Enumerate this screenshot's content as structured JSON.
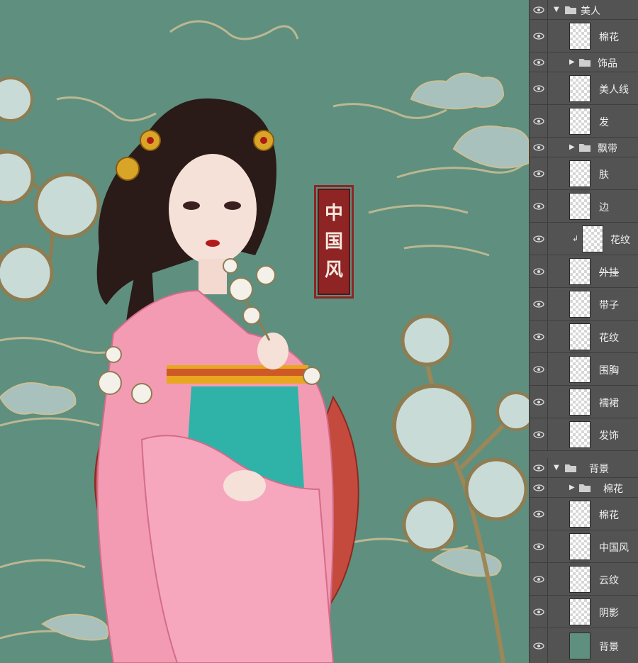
{
  "artwork": {
    "seal_text": [
      "中",
      "国",
      "风"
    ],
    "background_color": "#5f8f7e",
    "seal_color": "#8e2424"
  },
  "layers_panel": {
    "rows": [
      {
        "label": "美人",
        "kind": "group",
        "expanded": true,
        "visible": true
      },
      {
        "label": "棉花",
        "kind": "layer",
        "visible": true
      },
      {
        "label": "饰品",
        "kind": "group",
        "expanded": false,
        "visible": true
      },
      {
        "label": "美人线",
        "kind": "layer",
        "visible": true
      },
      {
        "label": "发",
        "kind": "layer",
        "visible": true
      },
      {
        "label": "飘带",
        "kind": "group",
        "expanded": false,
        "visible": true
      },
      {
        "label": "肤",
        "kind": "layer",
        "visible": true
      },
      {
        "label": "边",
        "kind": "layer",
        "visible": true
      },
      {
        "label": "花纹",
        "kind": "clipped-layer",
        "visible": true
      },
      {
        "label": "外挂",
        "kind": "layer",
        "visible": true,
        "strike": true
      },
      {
        "label": "带子",
        "kind": "layer",
        "visible": true
      },
      {
        "label": "花纹",
        "kind": "layer",
        "visible": true
      },
      {
        "label": "围胸",
        "kind": "layer",
        "visible": true
      },
      {
        "label": "襦裙",
        "kind": "layer",
        "visible": true
      },
      {
        "label": "发饰",
        "kind": "layer",
        "visible": true
      },
      {
        "label": "背景",
        "kind": "group",
        "expanded": true,
        "visible": true
      },
      {
        "label": "棉花",
        "kind": "group",
        "expanded": false,
        "visible": true
      },
      {
        "label": "棉花",
        "kind": "layer",
        "visible": true
      },
      {
        "label": "中国风",
        "kind": "layer",
        "visible": true
      },
      {
        "label": "云纹",
        "kind": "layer",
        "visible": true
      },
      {
        "label": "阴影",
        "kind": "layer",
        "visible": true
      },
      {
        "label": "背景",
        "kind": "layer",
        "visible": true,
        "solid_thumb": true
      }
    ]
  },
  "icons": {
    "eye": "eye-icon",
    "folder": "folder-icon",
    "expand": "triangle-down-icon",
    "collapse": "triangle-right-icon",
    "clip": "clipping-mask-icon"
  }
}
